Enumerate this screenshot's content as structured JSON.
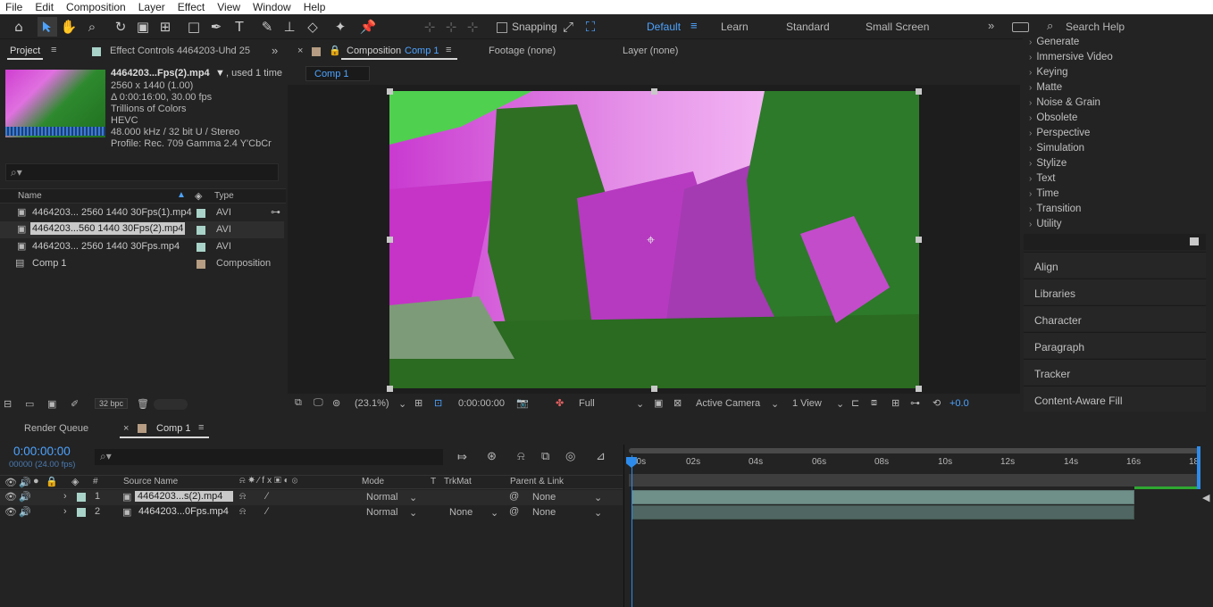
{
  "menu": [
    "File",
    "Edit",
    "Composition",
    "Layer",
    "Effect",
    "View",
    "Window",
    "Help"
  ],
  "toolbar": {
    "snapping_label": "Snapping",
    "workspaces": [
      "Default",
      "Learn",
      "Standard",
      "Small Screen"
    ],
    "active_workspace": "Default",
    "search_placeholder": "Search Help"
  },
  "project": {
    "tab_label": "Project",
    "effect_controls_label": "Effect Controls 4464203-Uhd 25",
    "selected_file": "4464203...Fps(2).mp4",
    "used_text": ", used 1 time",
    "info": [
      "2560 x 1440 (1.00)",
      "Δ 0:00:16:00, 30.00 fps",
      "Trillions of Colors",
      "HEVC",
      "48.000 kHz / 32 bit U / Stereo",
      "Profile: Rec. 709 Gamma 2.4 Y'CbCr"
    ],
    "col_name": "Name",
    "col_type": "Type",
    "items": [
      {
        "name": "4464203... 2560 1440 30Fps(1).mp4",
        "type": "AVI",
        "color": "#a9d2c8"
      },
      {
        "name": "4464203...560 1440 30Fps(2).mp4",
        "type": "AVI",
        "color": "#a9d2c8"
      },
      {
        "name": "4464203... 2560 1440 30Fps.mp4",
        "type": "AVI",
        "color": "#a9d2c8"
      },
      {
        "name": "Comp 1",
        "type": "Composition",
        "color": "#b59c82"
      }
    ],
    "bpc": "32 bpc"
  },
  "composition": {
    "tab_label": "Composition",
    "comp_name": "Comp 1",
    "footage_label": "Footage (none)",
    "layer_label": "Layer (none)",
    "breadcrumb": "Comp 1",
    "zoom": "(23.1%)",
    "timecode": "0:00:00:00",
    "resolution": "Full",
    "camera": "Active Camera",
    "view": "1 View",
    "exposure": "+0.0"
  },
  "effects": [
    "Generate",
    "Immersive Video",
    "Keying",
    "Matte",
    "Noise & Grain",
    "Obsolete",
    "Perspective",
    "Simulation",
    "Stylize",
    "Text",
    "Time",
    "Transition",
    "Utility"
  ],
  "side_panels": [
    "Align",
    "Libraries",
    "Character",
    "Paragraph",
    "Tracker",
    "Content-Aware Fill"
  ],
  "timeline": {
    "render_queue_label": "Render Queue",
    "comp_tab_label": "Comp 1",
    "timecode": "0:00:00:00",
    "frames": "00000 (24.00 fps)",
    "headers": {
      "source": "Source Name",
      "mode": "Mode",
      "t": "T",
      "trkmat": "TrkMat",
      "parent": "Parent & Link"
    },
    "ruler": [
      "00s",
      "02s",
      "04s",
      "06s",
      "08s",
      "10s",
      "12s",
      "14s",
      "16s",
      "18"
    ],
    "layers": [
      {
        "num": "1",
        "name": "4464203...s(2).mp4",
        "mode": "Normal",
        "trkmat": "",
        "parent": "None",
        "color": "#a9d2c8"
      },
      {
        "num": "2",
        "name": "4464203...0Fps.mp4",
        "mode": "Normal",
        "trkmat": "None",
        "parent": "None",
        "color": "#a9d2c8"
      }
    ]
  },
  "colors": {
    "accent": "#2d8ceb",
    "bg": "#232323",
    "panel": "#1d1d1d"
  }
}
